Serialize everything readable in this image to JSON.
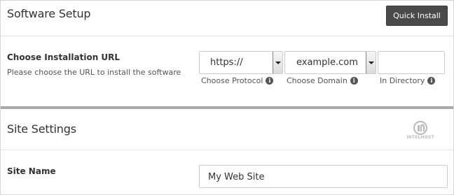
{
  "software_setup": {
    "title": "Software Setup",
    "quick_install_label": "Quick Install",
    "install_url": {
      "label": "Choose Installation URL",
      "description": "Please choose the URL to install the software",
      "protocol": {
        "value": "https://",
        "caption": "Choose Protocol"
      },
      "domain": {
        "value": "example.com",
        "caption": "Choose Domain"
      },
      "directory": {
        "value": "",
        "caption": "In Directory"
      }
    }
  },
  "site_settings": {
    "title": "Site Settings",
    "logo_text": "INTELHOST",
    "site_name": {
      "label": "Site Name",
      "value": "My Web Site"
    }
  },
  "colors": {
    "button_bg": "#4a4a4a",
    "divider": "#a8a8a8"
  },
  "icons": {
    "info": "info-icon",
    "dropdown": "chevron-down-icon"
  }
}
